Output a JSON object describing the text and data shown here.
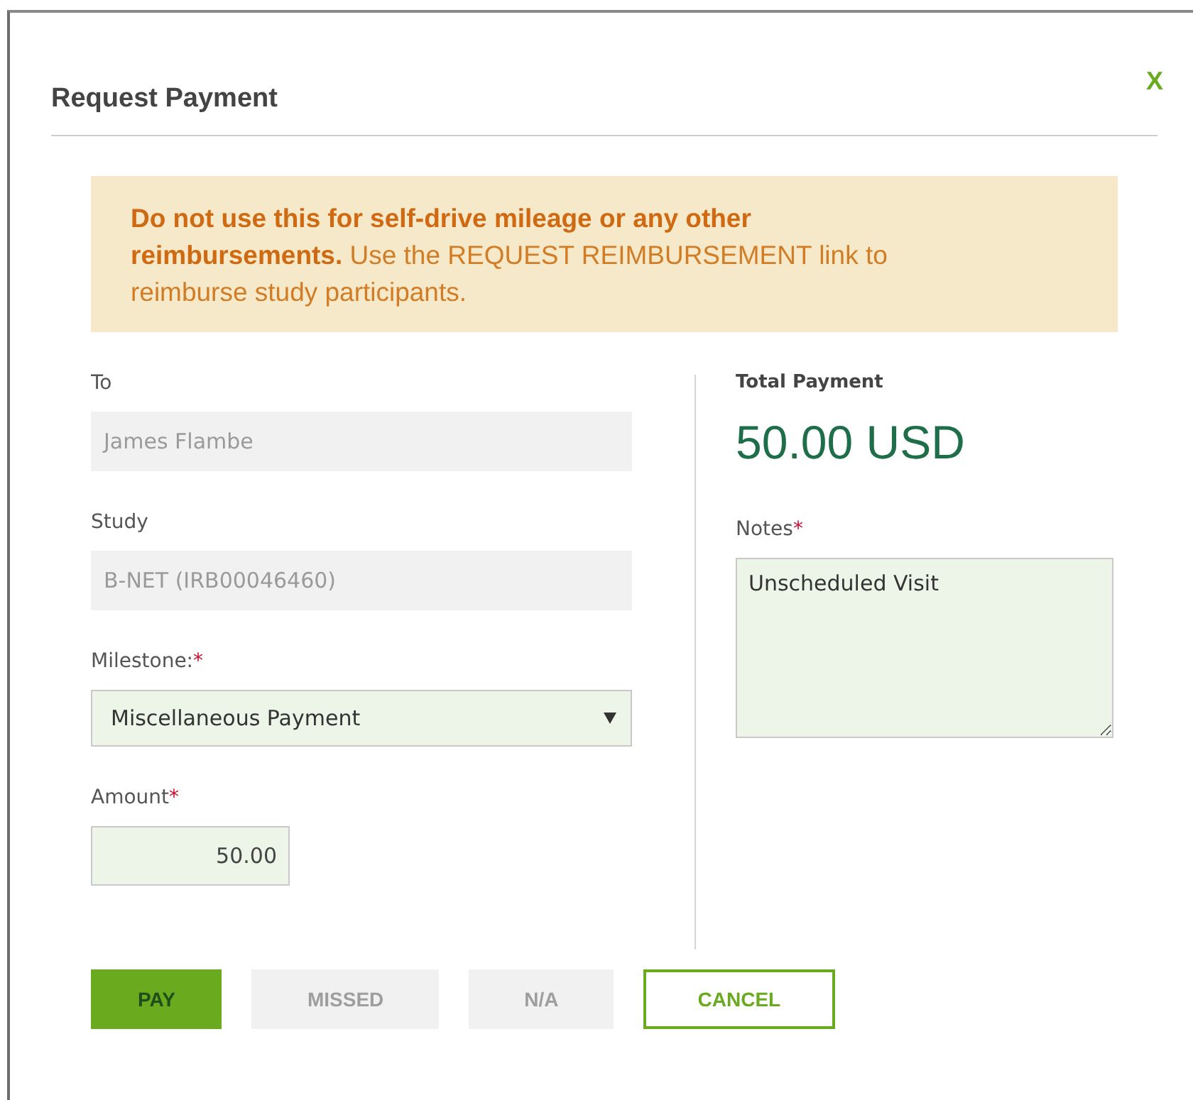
{
  "dialog": {
    "title": "Request Payment",
    "close": "X"
  },
  "alert": {
    "text": "**Do not use this for self-drive mileage or any other reimbursements.** Use the REQUEST REIMBURSEMENT link to reimburse study participants."
  },
  "fields": [
    {
      "kind": "text",
      "label": "To",
      "value": "James Flambe",
      "disabled": true
    },
    {
      "kind": "text",
      "label": "Study",
      "value": "B-NET (IRB00046460)",
      "disabled": true
    },
    {
      "kind": "select",
      "label": "Milestone:",
      "required_mark": "*",
      "value": "Miscellaneous Payment"
    },
    {
      "kind": "amount",
      "label": "Amount",
      "required_mark": "*",
      "value": "50.00"
    }
  ],
  "total": {
    "label": "Total Payment",
    "value": "50.00 USD"
  },
  "notes": {
    "label": "Notes",
    "required_mark": "*",
    "value": "Unscheduled Visit"
  },
  "buttons": [
    {
      "label": "PAY",
      "kind": "primary",
      "disabled": false
    },
    {
      "label": "MISSED",
      "kind": "secondary",
      "disabled": true
    },
    {
      "label": "N/A",
      "kind": "secondary",
      "disabled": true
    },
    {
      "label": "CANCEL",
      "kind": "outline",
      "disabled": false
    }
  ]
}
